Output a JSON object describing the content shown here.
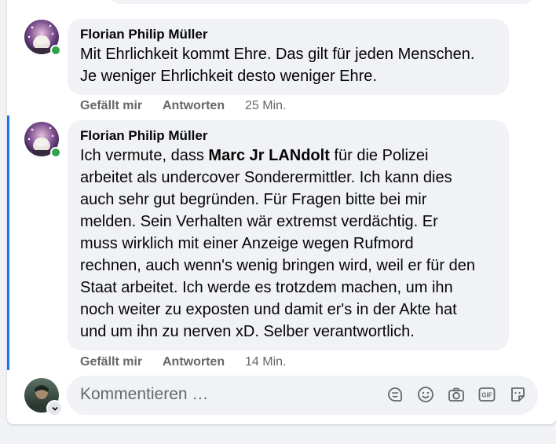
{
  "comments": [
    {
      "author": "Florian Philip Müller",
      "text_lines": [
        "Mit Ehrlichkeit kommt Ehre. Das gilt für jeden Menschen.",
        "Je weniger Ehrlichkeit desto weniger Ehre."
      ],
      "like_label": "Gefällt mir",
      "reply_label": "Antworten",
      "time": "25 Min.",
      "online": true
    },
    {
      "author": "Florian Philip Müller",
      "text_prefix": "Ich vermute, dass ",
      "mention": "Marc Jr LANdolt",
      "text_suffix": " für die Polizei",
      "text_lines": [
        "arbeitet als undercover Sonderermittler. Ich kann dies",
        "auch sehr gut begründen. Für Fragen bitte bei mir",
        "melden. Sein Verhalten wär extremst verdächtig. Er",
        "muss wirklich mit einer Anzeige wegen Rufmord",
        "rechnen, auch wenn's wenig bringen wird, weil er für den",
        "Staat arbeitet. Ich werde es trotzdem machen, um ihn",
        "noch weiter zu exposten und damit er's in der Akte hat",
        "und um ihn zu nerven xD. Selber verantwortlich."
      ],
      "like_label": "Gefällt mir",
      "reply_label": "Antworten",
      "time": "14 Min.",
      "online": true
    }
  ],
  "composer": {
    "placeholder": "Kommentieren …",
    "icons": [
      "avatar-sticker-icon",
      "emoji-icon",
      "camera-icon",
      "gif-icon",
      "sticker-icon"
    ]
  },
  "colors": {
    "bubble": "#f0f2f5",
    "thread_line": "#1877f2",
    "online": "#31a24c",
    "secondary_text": "#65676b"
  }
}
